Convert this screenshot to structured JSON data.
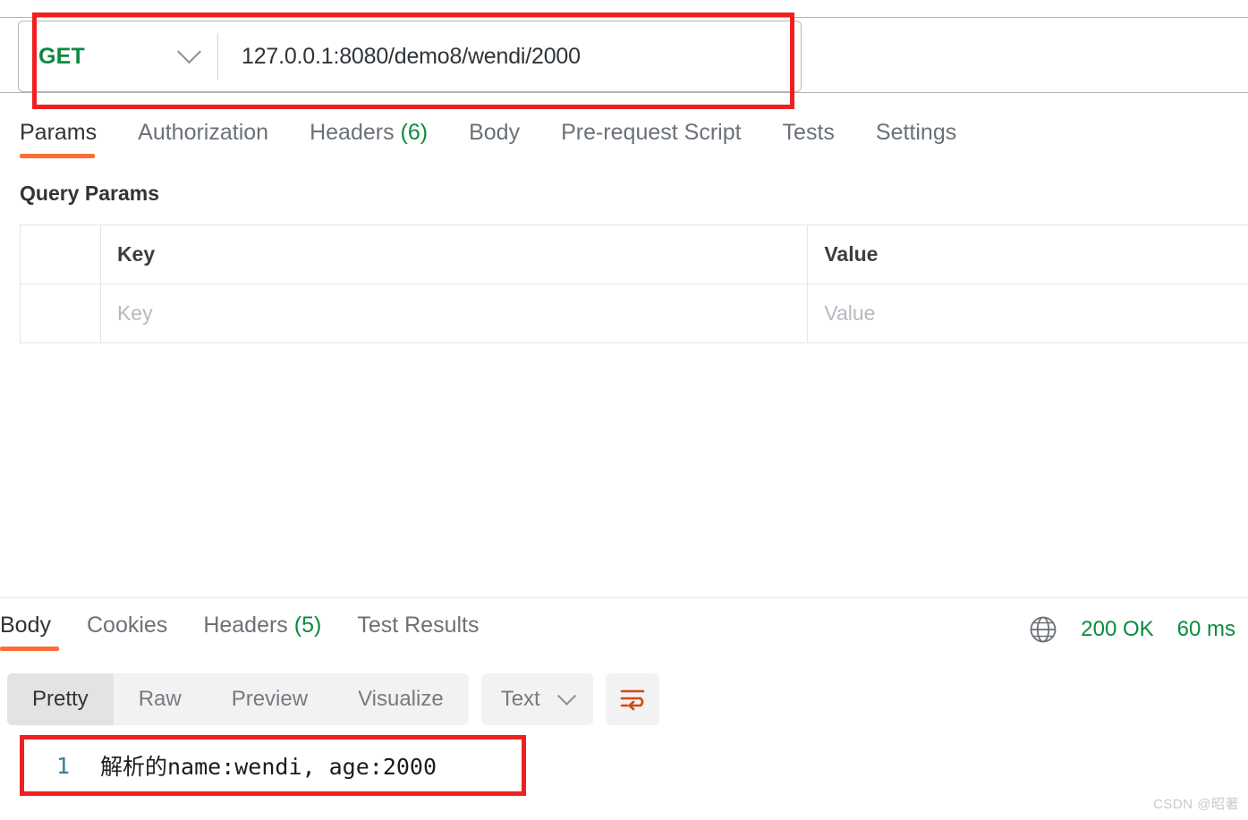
{
  "request": {
    "method": "GET",
    "method_color": "#0c8a3e",
    "url": "127.0.0.1:8080/demo8/wendi/2000",
    "dropdown_icon": "chevron-down-icon",
    "tabs": [
      {
        "label": "Params",
        "active": true,
        "count": ""
      },
      {
        "label": "Authorization",
        "active": false,
        "count": ""
      },
      {
        "label": "Headers",
        "active": false,
        "count": "(6)"
      },
      {
        "label": "Body",
        "active": false,
        "count": ""
      },
      {
        "label": "Pre-request Script",
        "active": false,
        "count": ""
      },
      {
        "label": "Tests",
        "active": false,
        "count": ""
      },
      {
        "label": "Settings",
        "active": false,
        "count": ""
      }
    ]
  },
  "query_params": {
    "title": "Query Params",
    "columns": [
      "",
      "Key",
      "Value"
    ],
    "rows": [
      {
        "key_placeholder": "Key",
        "value_placeholder": "Value"
      }
    ]
  },
  "response": {
    "tabs": [
      {
        "label": "Body",
        "active": true,
        "count": ""
      },
      {
        "label": "Cookies",
        "active": false,
        "count": ""
      },
      {
        "label": "Headers",
        "active": false,
        "count": "(5)"
      },
      {
        "label": "Test Results",
        "active": false,
        "count": ""
      }
    ],
    "status_icon": "globe-icon",
    "status_code": "200 OK",
    "time": "60 ms",
    "status_color": "#0c8a3e",
    "view_options": [
      {
        "label": "Pretty",
        "active": true
      },
      {
        "label": "Raw",
        "active": false
      },
      {
        "label": "Preview",
        "active": false
      },
      {
        "label": "Visualize",
        "active": false
      }
    ],
    "format": "Text",
    "format_dropdown_icon": "chevron-down-icon",
    "wrap_icon": "word-wrap-icon",
    "body_lines": [
      {
        "number": "1",
        "text": "解析的name:wendi, age:2000"
      }
    ]
  },
  "annotations": {
    "color": "#ef2020",
    "boxes": [
      "url-bar-highlight",
      "response-body-highlight"
    ]
  },
  "watermark": "CSDN @昭著"
}
